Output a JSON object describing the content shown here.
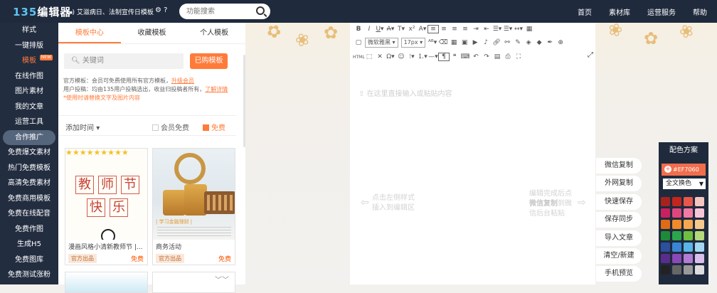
{
  "header": {
    "logo_num": "135",
    "logo_text": "编辑器",
    "notice": "艾滋病日、法制宣传日模板",
    "search_placeholder": "功能搜索",
    "nav": [
      "首页",
      "素材库",
      "运营服务",
      "帮助"
    ]
  },
  "sidebar": {
    "items": [
      "样式",
      "一键排版",
      "模板",
      "在线作图",
      "图片素材",
      "我的文章",
      "运营工具",
      "合作推广",
      "免费爆文素材",
      "热门免费模板",
      "高清免费素材",
      "免费商用模板",
      "免费在线配音",
      "免费作图",
      "生成H5",
      "免费图库",
      "免费测试涨粉"
    ],
    "new_badge": "NEW"
  },
  "panel": {
    "tabs": [
      "模板中心",
      "收藏模板",
      "个人模板"
    ],
    "search_placeholder": "关键词",
    "bought_button": "已购模板",
    "info_line1": "官方模板：会员可免费使用所有官方模板，",
    "info_link1": "升级会员",
    "info_line2": "用户投稿：均由135用户投稿选出，收益归投稿者所有，",
    "info_link2": "了解详情",
    "info_warn": "*使用时请替换文字及图片内容",
    "sort_label": "添加时间",
    "member_free_label": "会员免费",
    "free_label": "免费",
    "cards": [
      {
        "title": "漫画风格小清新教师节 |...",
        "tag": "官方出品",
        "price": "免费",
        "chars": [
          "教",
          "师",
          "节",
          "快",
          "乐"
        ]
      },
      {
        "title": "商务活动",
        "tag": "官方出品",
        "price": "免费",
        "banner": "| 学习金融理财 |"
      }
    ]
  },
  "toolbar": {
    "font_family": "微软雅黑",
    "font_size": "17px",
    "format_label": "HTML"
  },
  "editor": {
    "placeholder": "在这里直接输入或粘贴内容",
    "hint_left_1": "点击左侧样式",
    "hint_left_2": "插入到编辑区",
    "hint_right_1": "编辑完成后点",
    "hint_right_2": "微信复制",
    "hint_right_3": "到微",
    "hint_right_4": "信后台粘贴"
  },
  "actions": [
    "微信复制",
    "外网复制",
    "快速保存",
    "保存同步",
    "导入文章",
    "清空/新建",
    "手机预览"
  ],
  "palette": {
    "title": "配色方案",
    "hex": "#EF7060",
    "mode": "全文换色",
    "swatches": [
      "#a8221c",
      "#c3261d",
      "#e8574a",
      "#f5c6c0",
      "#c9215f",
      "#e0467e",
      "#f07aa3",
      "#f6c6d8",
      "#e06b16",
      "#f08a2a",
      "#f5a84f",
      "#f7c88e",
      "#1d8a3a",
      "#2ba64b",
      "#6fbf3e",
      "#b3d97a",
      "#2c4f9e",
      "#3a86d4",
      "#59b4e8",
      "#a4d6f2",
      "#5a2c8c",
      "#8a49b8",
      "#b27cd4",
      "#d9bfe9",
      "#222222",
      "#666666",
      "#999999",
      "#dddddd"
    ]
  }
}
